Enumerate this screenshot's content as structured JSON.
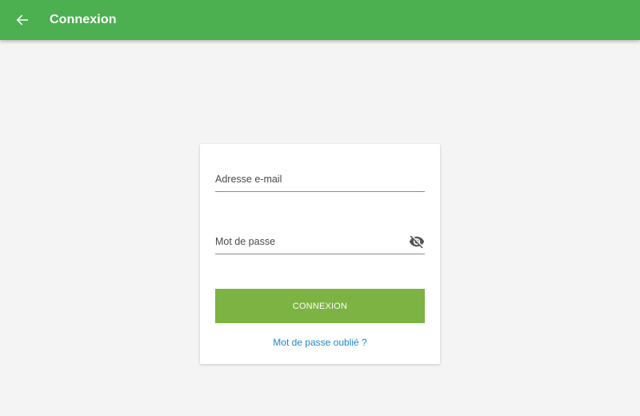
{
  "appbar": {
    "title": "Connexion",
    "back_icon": "arrow-back-icon",
    "color": "#4caf50"
  },
  "form": {
    "email": {
      "placeholder": "Adresse e-mail",
      "value": ""
    },
    "password": {
      "placeholder": "Mot de passe",
      "value": "",
      "toggle_icon": "eye-off-icon"
    },
    "submit_label": "CONNEXION",
    "submit_color": "#7cb342",
    "forgot_label": "Mot de passe oublié ?",
    "link_color": "#1e88c9"
  }
}
